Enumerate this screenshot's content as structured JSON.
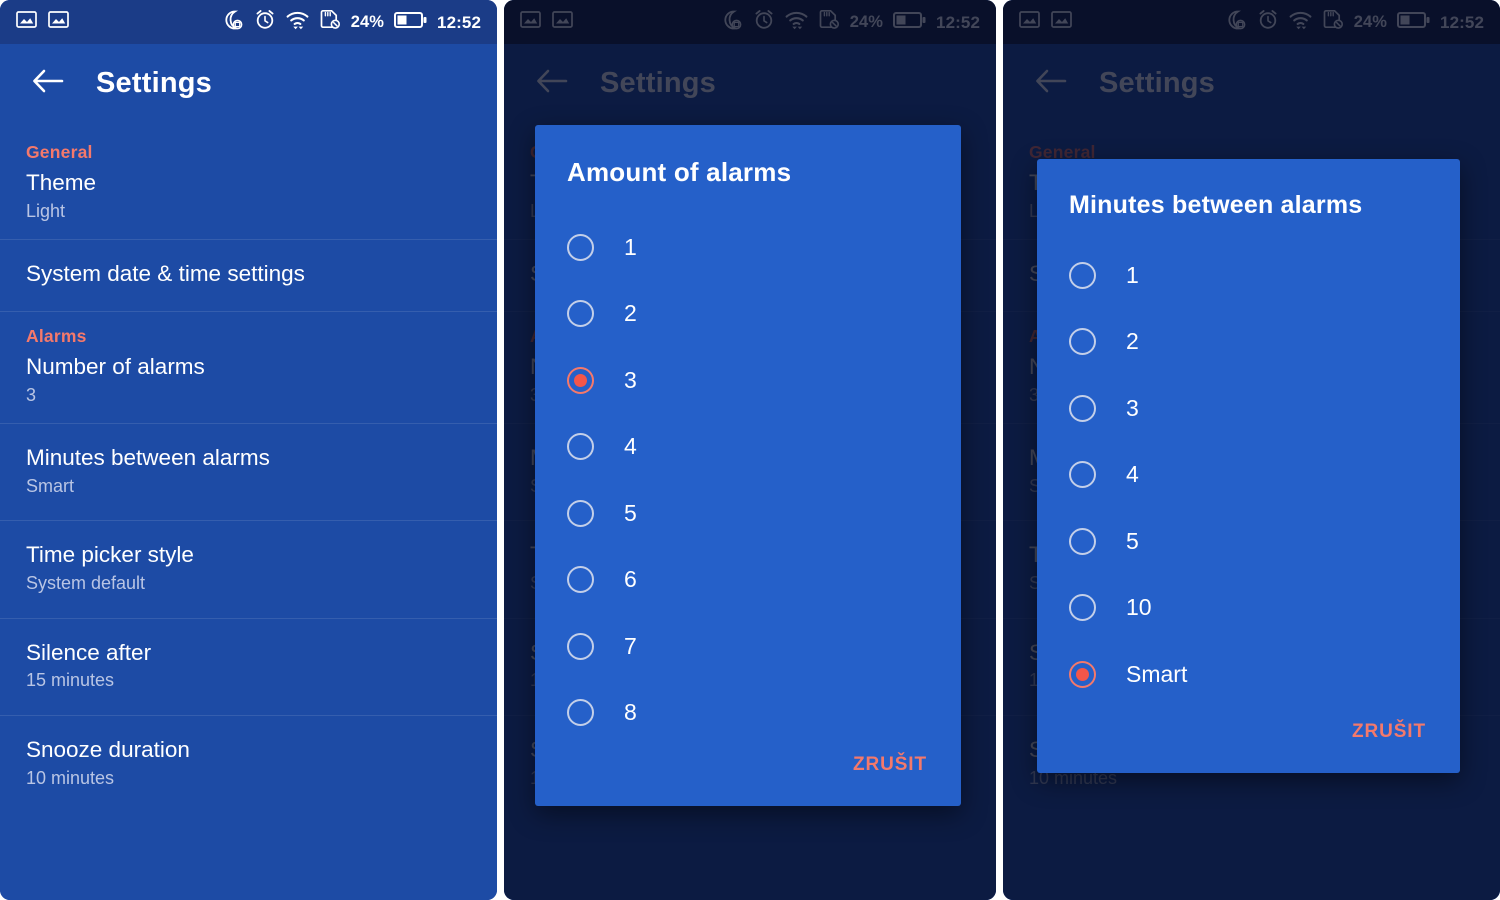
{
  "status_bar": {
    "left_icons": [
      "image-icon",
      "image-icon"
    ],
    "right_icons": [
      "do-not-disturb-moon-icon",
      "alarm-clock-icon",
      "wifi-icon",
      "sd-card-off-icon"
    ],
    "battery_percent": "24%",
    "clock": "12:52"
  },
  "app_bar": {
    "back_icon": "arrow-back-icon",
    "title": "Settings"
  },
  "settings_list": {
    "sections": [
      {
        "header": "General",
        "items": [
          {
            "title": "Theme",
            "value": "Light"
          },
          {
            "title": "System date & time settings",
            "value": ""
          }
        ]
      },
      {
        "header": "Alarms",
        "items": [
          {
            "title": "Number of alarms",
            "value": "3"
          },
          {
            "title": "Minutes between alarms",
            "value": "Smart"
          },
          {
            "title": "Time picker style",
            "value": "System default"
          },
          {
            "title": "Silence after",
            "value": "15 minutes"
          },
          {
            "title": "Snooze duration",
            "value": "10 minutes"
          }
        ]
      }
    ]
  },
  "dialog_amount": {
    "title": "Amount of alarms",
    "options": [
      "1",
      "2",
      "3",
      "4",
      "5",
      "6",
      "7",
      "8"
    ],
    "selected": "3",
    "cancel_label": "ZRUŠIT"
  },
  "dialog_minutes": {
    "title": "Minutes between alarms",
    "options": [
      "1",
      "2",
      "3",
      "4",
      "5",
      "10",
      "Smart"
    ],
    "selected": "Smart",
    "cancel_label": "ZRUŠIT"
  },
  "colors": {
    "surface": "#1d4ba5",
    "status_bar": "#1b3c87",
    "dialog": "#2560c9",
    "accent": "#f4796b",
    "radio_selected_dot": "#f4564a",
    "secondary_text": "#b9c5e4",
    "scrim": "rgba(6,12,35,0.76)"
  }
}
